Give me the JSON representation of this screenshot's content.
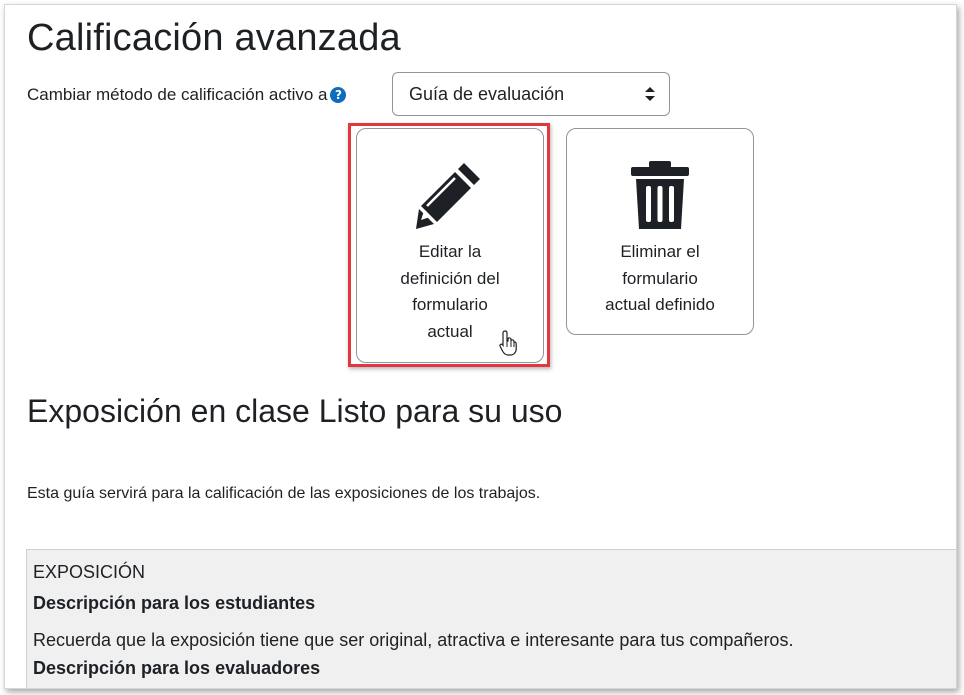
{
  "page": {
    "title": "Calificación avanzada"
  },
  "method": {
    "label": "Cambiar método de calificación activo a",
    "help_icon_glyph": "?",
    "selected": "Guía de evaluación"
  },
  "actions": {
    "edit": {
      "lines": [
        "Editar la",
        "definición del",
        "formulario",
        "actual"
      ],
      "icon": "pencil-icon"
    },
    "delete": {
      "lines": [
        "Eliminar el",
        "formulario",
        "actual definido"
      ],
      "icon": "trash-icon"
    }
  },
  "definition": {
    "title": "Exposición en clase Listo para su uso",
    "description": "Esta guía servirá para la calificación de las exposiciones de los trabajos."
  },
  "criterion": {
    "name": "EXPOSICIÓN",
    "students_heading": "Descripción para los estudiantes",
    "students_text": "Recuerda que la exposición tiene que ser original, atractiva e interesante para tus compañeros.",
    "evaluators_heading": "Descripción para los evaluadores"
  },
  "colors": {
    "highlight": "#e0383e",
    "help_icon": "#0f6cbf",
    "text": "#1d2125"
  }
}
